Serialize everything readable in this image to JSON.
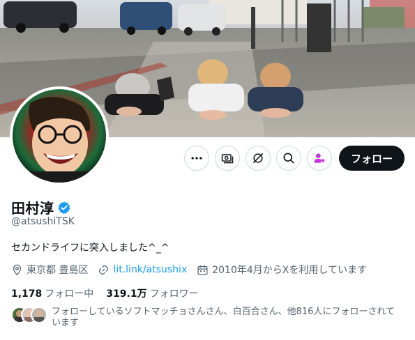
{
  "profile": {
    "display_name": "田村淳",
    "handle": "@atsushiTSK",
    "bio": "セカンドライフに突入しました^_^",
    "location": "東京都 豊島区",
    "website": "lit.link/atsushix",
    "joined": "2010年4月からXを利用しています",
    "following_count": "1,178",
    "following_label": "フォロー中",
    "followers_count": "319.1万",
    "followers_label": "フォロワー",
    "followed_by": "フォローしているソフトマッチョさんさん、白百合さん、他816人にフォローされています"
  },
  "actions": {
    "more_icon": "ellipsis-icon",
    "subscribe_icon": "money-icon",
    "grok_icon": "grok-icon",
    "search_icon": "search-icon",
    "notify_icon": "person-star-icon",
    "follow_label": "フォロー"
  },
  "colors": {
    "accent": "#1d9bf0",
    "text_primary": "#0f1419",
    "text_secondary": "#536471",
    "follow_button_bg": "#0f1419",
    "notify_icon": "#c236d8"
  }
}
